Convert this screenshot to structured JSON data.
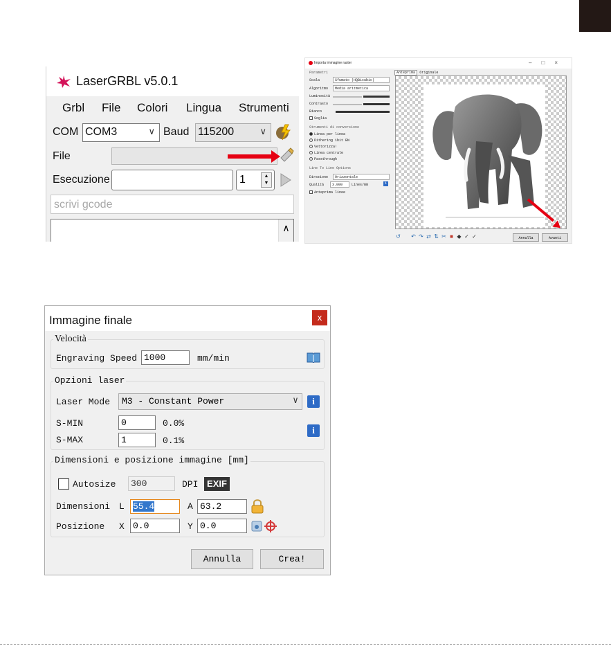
{
  "lasergrbl": {
    "title": "LaserGRBL v5.0.1",
    "menu": [
      "Grbl",
      "File",
      "Colori",
      "Lingua",
      "Strumenti"
    ],
    "com_label": "COM",
    "com_value": "COM3",
    "baud_label": "Baud",
    "baud_value": "115200",
    "file_label": "File",
    "exec_label": "Esecuzione",
    "passes_value": "1",
    "gcode_placeholder": "scrivi gcode",
    "icons": {
      "connect": "connect-bolt-icon",
      "open_file": "open-file-icon",
      "run": "run-play-icon"
    }
  },
  "import_raster": {
    "title": "Importa immagine raster",
    "params_header": "Parametri",
    "scala_label": "Scala",
    "scala_value": "Sfumato (HQBicubic)",
    "algoritmo_label": "Algoritmo",
    "algoritmo_value": "Media aritmetica",
    "luminosita_label": "Luminosità",
    "contrasto_label": "Contrasto",
    "bianco_label": "Bianco",
    "soglia_label": "Soglia",
    "tools_header": "Strumenti di conversione",
    "tools": [
      "Linea per linea",
      "Dithering 1bit BN",
      "Vettorizza!",
      "Linea centrale",
      "Passthrough"
    ],
    "l2l_header": "Line To Line Options",
    "direzione_label": "Direzione",
    "direzione_value": "Orizzontale",
    "qualita_label": "Qualità",
    "qualita_value": "3.000",
    "qualita_unit": "Lines/mm",
    "anteprima_linee": "Anteprima linee",
    "tabs": [
      "Anteprima",
      "Originale"
    ],
    "annulla": "Annulla",
    "avanti": "Avanti"
  },
  "immagine_finale": {
    "title": "Immagine finale",
    "close": "x",
    "velocita_header": "Velocità",
    "engraving_label": "Engraving Speed",
    "engraving_value": "1000",
    "engraving_unit": "mm/min",
    "laser_header": "Opzioni laser",
    "laser_mode_label": "Laser Mode",
    "laser_mode_value": "M3 - Constant Power",
    "smin_label": "S-MIN",
    "smin_value": "0",
    "smin_pct": "0.0%",
    "smax_label": "S-MAX",
    "smax_value": "1",
    "smax_pct": "0.1%",
    "dim_header": "Dimensioni e posizione immagine [mm]",
    "autosize_label": "Autosize",
    "dpi_value": "300",
    "dpi_label": "DPI",
    "exif_label": "EXIF",
    "dimensioni_label": "Dimensioni",
    "l_label": "L",
    "l_value": "55.4",
    "a_label": "A",
    "a_value": "63.2",
    "posizione_label": "Posizione",
    "x_label": "X",
    "x_value": "0.0",
    "y_label": "Y",
    "y_value": "0.0",
    "annulla": "Annulla",
    "crea": "Crea!"
  },
  "colors": {
    "accent_red": "#e60012",
    "info_blue": "#2e6bc6",
    "close_red": "#c42b1c"
  }
}
